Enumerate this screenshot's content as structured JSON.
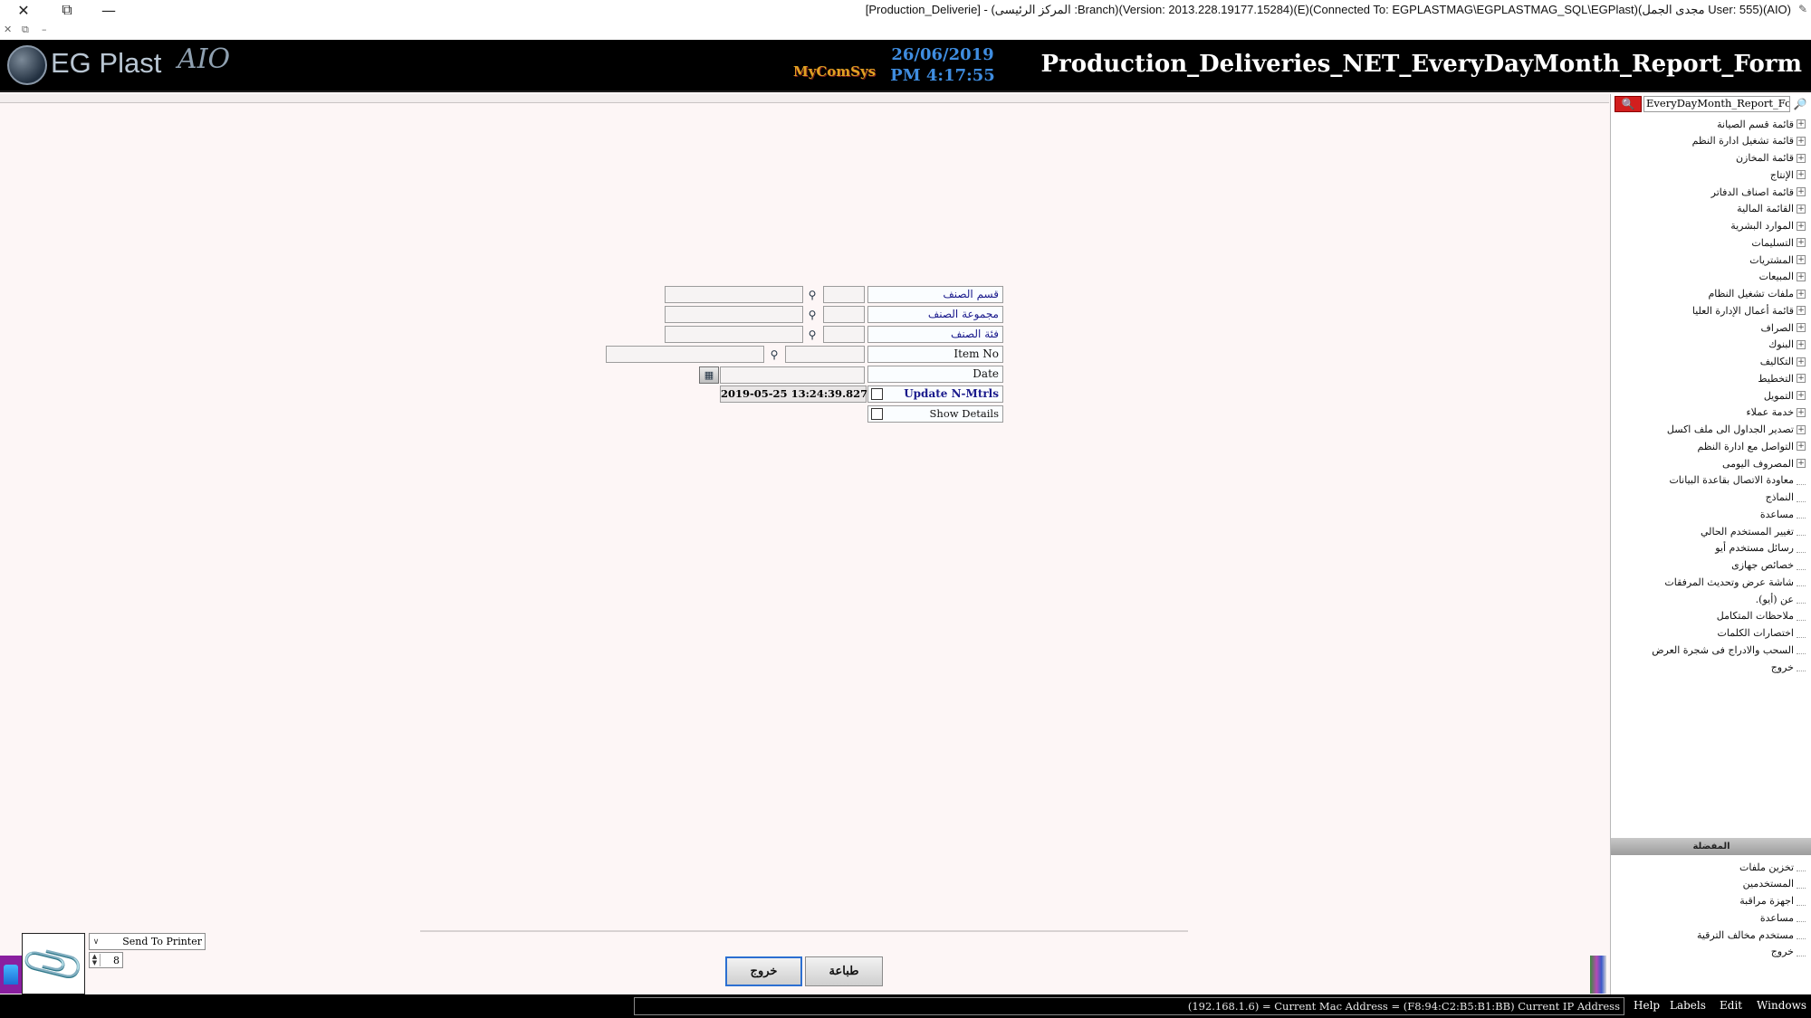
{
  "window": {
    "title": "[Production_Deliverie] - (المركز الرئيسى :Branch)(Version: 2013.228.19177.15284)(E)(Connected To: EGPLASTMAG\\EGPLASTMAG_SQL\\EGPlast)(مجدى الجمل User: 555)(AIO)",
    "close_glyph": "✕",
    "restore_glyph": "⧉",
    "minimize_glyph": "—",
    "mdi_close_glyph": "✕",
    "mdi_restore_glyph": "⧉",
    "mdi_min_glyph": "–",
    "pin_glyph": "✎"
  },
  "header": {
    "logo_text": "EG Plast",
    "logo_sub": "AIO",
    "brand_small": "MyComSys",
    "date": "26/06/2019",
    "time": "PM 4:17:55",
    "form_title": "Production_Deliveries_NET_EveryDayMonth_Report_Form"
  },
  "sidebar": {
    "search_value": "EveryDayMonth_Report_Form",
    "search_button_glyph": "🔍",
    "search_icon_glyph": "🔎",
    "menu_items": [
      {
        "label": "قائمة قسم الصيانة",
        "expandable": true
      },
      {
        "label": "قائمة تشغيل ادارة النظم",
        "expandable": true
      },
      {
        "label": "قائمة المخازن",
        "expandable": true
      },
      {
        "label": "الإنتاج",
        "expandable": true
      },
      {
        "label": "قائمة اصناف الدفاتر",
        "expandable": true
      },
      {
        "label": "القائمة المالية",
        "expandable": true
      },
      {
        "label": "الموارد البشرية",
        "expandable": true
      },
      {
        "label": "التسليمات",
        "expandable": true
      },
      {
        "label": "المشتريات",
        "expandable": true
      },
      {
        "label": "المبيعات",
        "expandable": true
      },
      {
        "label": "ملفات تشغيل النظام",
        "expandable": true
      },
      {
        "label": "قائمة أعمال الإدارة العليا",
        "expandable": true
      },
      {
        "label": "الصراف",
        "expandable": true
      },
      {
        "label": "البنوك",
        "expandable": true
      },
      {
        "label": "التكاليف",
        "expandable": true
      },
      {
        "label": "التخطيط",
        "expandable": true
      },
      {
        "label": "التمويل",
        "expandable": true
      },
      {
        "label": "خدمة عملاء",
        "expandable": true
      },
      {
        "label": "تصدير الجداول الى ملف اكسل",
        "expandable": true
      },
      {
        "label": "التواصل مع ادارة النظم",
        "expandable": true
      },
      {
        "label": "المصروف اليومى",
        "expandable": true
      },
      {
        "label": "معاودة الاتصال بقاعدة البيانات",
        "expandable": false
      },
      {
        "label": "النماذج",
        "expandable": false
      },
      {
        "label": "مساعدة",
        "expandable": false
      },
      {
        "label": "تغيير المستخدم الحالي",
        "expandable": false
      },
      {
        "label": "رسائل مستخدم أيو",
        "expandable": false
      },
      {
        "label": "خصائص جهازى",
        "expandable": false
      },
      {
        "label": "شاشة عرض وتحديث المرفقات",
        "expandable": false
      },
      {
        "label": "عن (أيو).",
        "expandable": false
      },
      {
        "label": "ملاحظات المتكامل",
        "expandable": false
      },
      {
        "label": "اختصارات الكلمات",
        "expandable": false
      },
      {
        "label": "السحب والادراج فى شجرة العرض",
        "expandable": false
      },
      {
        "label": "خروج",
        "expandable": false
      }
    ],
    "favorites_header": "المفضلة",
    "favorites": [
      {
        "label": "تخزين ملفات"
      },
      {
        "label": "المستخدمين"
      },
      {
        "label": "اجهزة مراقبة"
      },
      {
        "label": "مساعدة"
      },
      {
        "label": "مستخدم مخالف الترقية"
      },
      {
        "label": "خروج"
      }
    ]
  },
  "form": {
    "item_section_label": "قسم الصنف",
    "item_group_label": "مجموعة الصنف",
    "item_category_label": "فئة الصنف",
    "item_no_label": "Item No",
    "date_label": "Date",
    "update_label": "Update N-Mtrls",
    "show_details_label": "Show Details",
    "timestamp": "2019-05-25 13:24:39.827",
    "lookup_glyph": "⚲",
    "calendar_glyph": "▦"
  },
  "buttons": {
    "exit": "خروج",
    "print": "طباعة"
  },
  "print_options": {
    "printer_label": "Send To Printer",
    "dropdown_glyph": "∨",
    "copies": "8",
    "stepper_up": "▲",
    "stepper_down": "▼",
    "attach_glyph": "📎"
  },
  "statusbar": {
    "info": "(192.168.1.6) = Current Mac Address = (F8:94:C2:B5:B1:BB) Current IP Address",
    "menu": [
      "Help",
      "Labels",
      "Edit",
      "Windows"
    ]
  }
}
